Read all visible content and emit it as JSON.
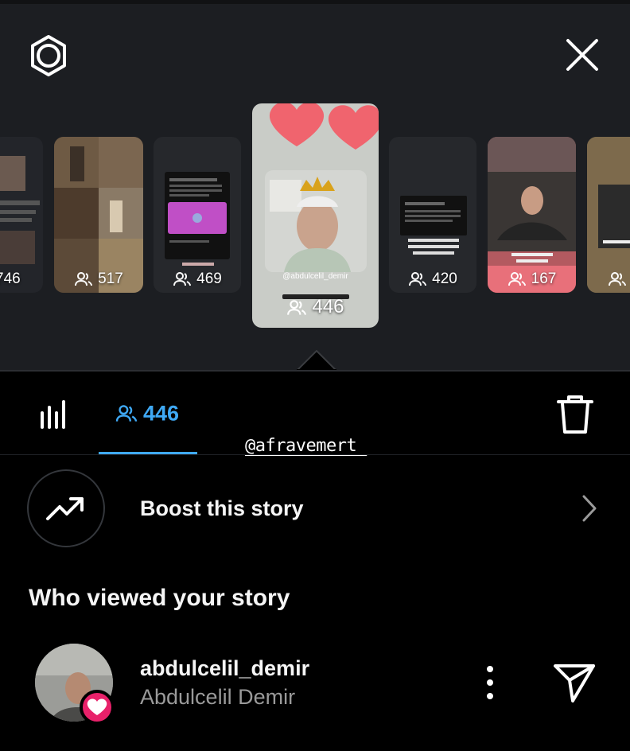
{
  "stories": [
    {
      "count": "746"
    },
    {
      "count": "517"
    },
    {
      "count": "469"
    },
    {
      "count": "446",
      "selected": true,
      "tag": "@abdulcelil_demir"
    },
    {
      "count": "420"
    },
    {
      "count": "167"
    }
  ],
  "tabs": {
    "insights_icon": "bar-chart-icon",
    "viewers_count": "446"
  },
  "mention": "@afravemert_",
  "boost": {
    "label": "Boost this story"
  },
  "viewers_section": {
    "title": "Who viewed your story"
  },
  "viewer": {
    "username": "abdulcelil_demir",
    "full_name": "Abdulcelil Demir"
  },
  "colors": {
    "accent": "#3fa9f5",
    "like_badge": "#e8216a",
    "background": "#000000",
    "top_panel": "#1c1e22"
  }
}
